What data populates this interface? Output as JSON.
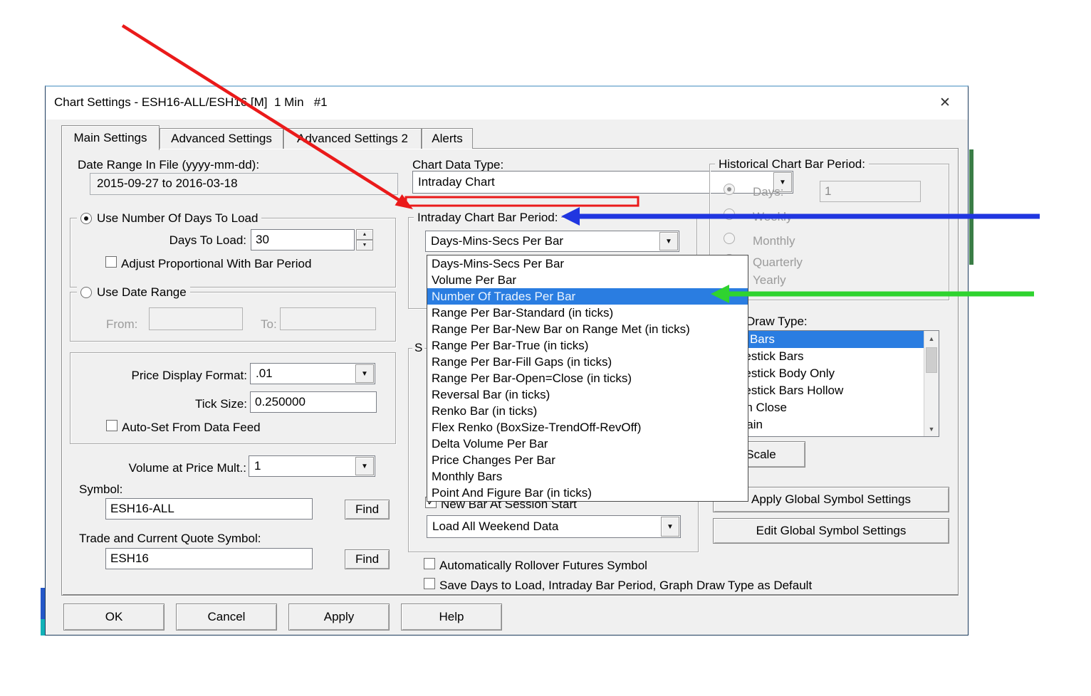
{
  "window": {
    "title": "Chart Settings - ESH16-ALL/ESH16 [M]  1 Min   #1",
    "close_glyph": "✕"
  },
  "tabs": [
    "Main Settings",
    "Advanced Settings",
    "Advanced Settings 2",
    "Alerts"
  ],
  "left": {
    "date_range_label": "Date Range In File (yyyy-mm-dd):",
    "date_range_value": "2015-09-27 to 2016-03-18",
    "use_days_label": "Use Number Of Days To Load",
    "days_to_load_label": "Days To Load:",
    "days_to_load_value": "30",
    "adjust_proportional_label": "Adjust Proportional With Bar Period",
    "use_date_range_label": "Use Date Range",
    "from_label": "From:",
    "to_label": "To:",
    "price_display_label": "Price Display Format:",
    "price_display_value": ".01",
    "tick_size_label": "Tick Size:",
    "tick_size_value": "0.250000",
    "auto_set_label": "Auto-Set From Data Feed",
    "volume_mult_label": "Volume at Price Mult.:",
    "volume_mult_value": "1",
    "symbol_label": "Symbol:",
    "symbol_value": "ESH16-ALL",
    "trade_symbol_label": "Trade and Current Quote Symbol:",
    "trade_symbol_value": "ESH16",
    "find_label": "Find"
  },
  "middle": {
    "chart_data_type_label": "Chart Data Type:",
    "chart_data_type_value": "Intraday Chart",
    "period_group_label": "Intraday Chart Bar Period:",
    "period_value": "Days-Mins-Secs Per Bar",
    "period_options": [
      "Days-Mins-Secs Per Bar",
      "Volume Per Bar",
      "Number Of Trades Per Bar",
      "Range Per Bar-Standard (in ticks)",
      "Range Per Bar-New Bar on Range Met (in ticks)",
      "Range Per Bar-True (in ticks)",
      "Range Per Bar-Fill Gaps (in ticks)",
      "Range Per Bar-Open=Close (in ticks)",
      "Reversal Bar (in ticks)",
      "Renko Bar (in ticks)",
      "Flex Renko (BoxSize-TrendOff-RevOff)",
      "Delta Volume Per Bar",
      "Price Changes Per Bar",
      "Monthly Bars",
      "Point And Figure Bar (in ticks)"
    ],
    "highlighted_option": "Number Of Trades Per Bar",
    "session_group_label_fragment": "S",
    "new_bar_label": "New Bar At Session Start",
    "weekend_value": "Load All Weekend Data",
    "rollover_label": "Automatically Rollover Futures Symbol",
    "save_default_label": "Save Days to Load, Intraday Bar Period, Graph Draw Type as Default"
  },
  "right": {
    "historical_group_label": "Historical Chart Bar Period:",
    "days_label": "Days:",
    "days_value": "1",
    "weekly_label": "Weekly",
    "monthly_label": "Monthly",
    "quarterly_label": "Quarterly",
    "yearly_label": "Yearly",
    "draw_type_label": "Graph Draw Type:",
    "draw_types": [
      "OHLC Bars",
      "Candlestick Bars",
      "Candlestick Body Only",
      "Candlestick Bars Hollow",
      "Line on Close",
      "Mountain"
    ],
    "selected_draw_type": "OHLC Bars",
    "scale_button": "Scale",
    "apply_global_button": "Apply Global Symbol Settings",
    "edit_global_button": "Edit Global Symbol Settings"
  },
  "footer": {
    "ok": "OK",
    "cancel": "Cancel",
    "apply": "Apply",
    "help": "Help"
  },
  "icons": {
    "dropdown": "▼",
    "spin_up": "▲",
    "spin_down": "▼",
    "scroll_up": "▲",
    "scroll_down": "▼",
    "check": "✓"
  },
  "colors": {
    "selection_blue": "#2a7de1",
    "annotation_red": "#ea1a1a",
    "annotation_blue": "#2036e0",
    "annotation_green": "#2fd32f"
  }
}
